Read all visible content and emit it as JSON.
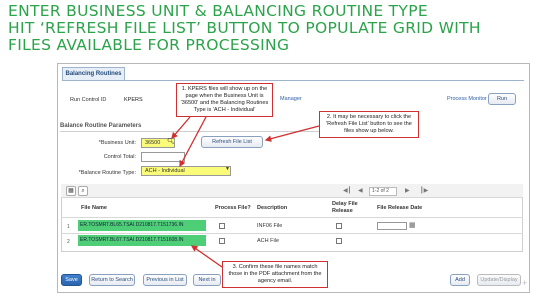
{
  "headline": {
    "line1": "ENTER BUSINESS UNIT & BALANCING ROUTINE TYPE",
    "line2": "HIT ‘REFRESH FILE LIST’ BUTTON TO POPULATE GRID WITH",
    "line3": "FILES AVAILABLE FOR PROCESSING"
  },
  "page": {
    "tab_label": "Balancing Routines",
    "run_control_label": "Run Control ID",
    "run_control_value": "KPERS",
    "manager_link": "Manager",
    "process_monitor_link": "Process Monitor",
    "run_button": "Run"
  },
  "params": {
    "section_title": "Balance Routine Parameters",
    "business_unit_label": "*Business Unit:",
    "business_unit_value": "36500",
    "control_total_label": "Control Total:",
    "routine_type_label": "*Balance Routine Type:",
    "routine_type_value": "ACH - Individual",
    "refresh_button": "Refresh File List"
  },
  "grid": {
    "pager_text": "1-2 of 2",
    "headers": [
      "File Name",
      "Process File?",
      "Description",
      "Delay File Release",
      "File Release Date"
    ],
    "rows": [
      {
        "num": "1",
        "file_name": "ER.TOSMRT.BL65.TSAI.D210817.T151736.IN",
        "description": "INF06 File"
      },
      {
        "num": "2",
        "file_name": "ER.TOSMRT.BL67.TSAI.D210817.T151608.IN",
        "description": "ACH File"
      }
    ]
  },
  "footer": {
    "save": "Save",
    "return_to_search": "Return to Search",
    "previous_in_list": "Previous in List",
    "next_in_list": "Next in",
    "add": "Add",
    "update_display": "Update/Display"
  },
  "callouts": {
    "c1": "1. KPERS files will show up on the page when the Business Unit is '36500' and the Balancing Routines Type is 'ACH - Individual'",
    "c2": "2. It may be necessary to click the 'Refresh File List' button to see the files show up below.",
    "c3": "3. Confirm these file names match those in the PDF attachment from the agency email."
  },
  "colors": {
    "headline": "#2ba34a",
    "callout_border": "#d03030",
    "file_highlight": "#4fce78",
    "field_highlight": "#fbfb7a"
  },
  "icons": {
    "lookup": "magnifier-icon",
    "calendar": "calendar-icon",
    "grid_personalize": "grid-icon",
    "grid_find": "search-icon",
    "first": "first-page-icon",
    "prev": "prev-page-icon",
    "next": "next-page-icon",
    "last": "last-page-icon"
  }
}
